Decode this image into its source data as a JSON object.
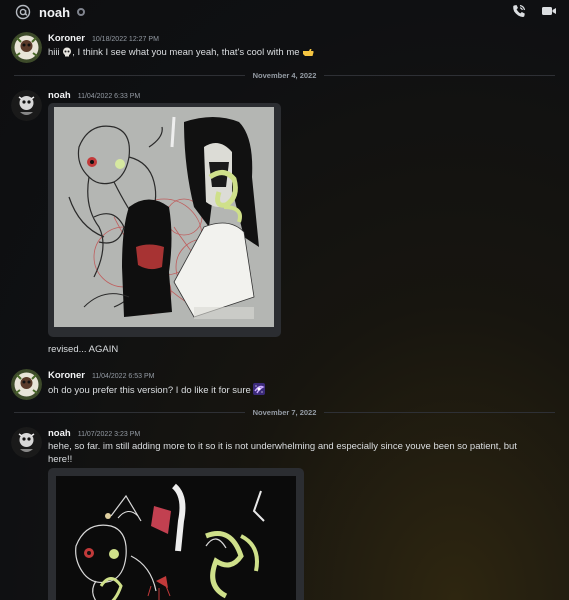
{
  "header": {
    "icon": "at-icon",
    "name": "noah",
    "status": "offline",
    "actions": [
      "phone-call-icon",
      "video-call-icon"
    ]
  },
  "messages": [
    {
      "username": "Koroner",
      "timestamp": "10/18/2022 12:27 PM",
      "text_before": "hiii",
      "text_after": ", I think I see what you mean yeah, that's cool with me"
    },
    {
      "divider": "November 4, 2022"
    },
    {
      "username": "noah",
      "timestamp": "11/04/2022 6:33 PM",
      "text": "revised... AGAIN"
    },
    {
      "username": "Koroner",
      "timestamp": "11/04/2022 6:53 PM",
      "text": "oh do you prefer this version? I do like it for sure"
    },
    {
      "divider": "November 7, 2022"
    },
    {
      "username": "noah",
      "timestamp": "11/07/2022 3:23 PM",
      "text_line1": "hehe, so far. im still adding more to it so it is not underwhelming and especially since youve been so patient, but",
      "text_line2": "here!!"
    }
  ],
  "colors": {
    "background": "#0f1012",
    "attachment_bg": "#2b2d31",
    "username": "#f2f3f5",
    "timestamp": "#949ba4",
    "text": "#dbdee1"
  }
}
